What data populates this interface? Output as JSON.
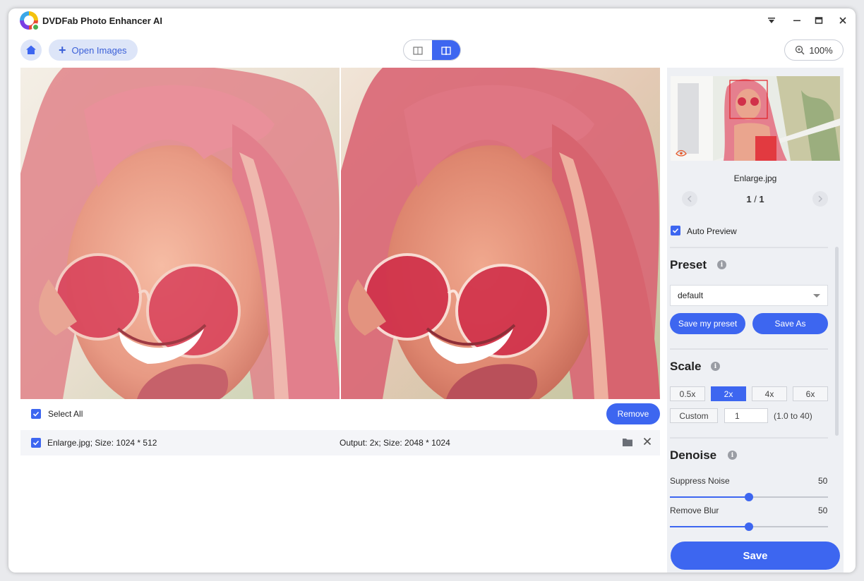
{
  "app": {
    "title": "DVDFab Photo Enhancer AI"
  },
  "toolbar": {
    "open_label": "Open Images",
    "zoom_label": "100%"
  },
  "list": {
    "select_all_label": "Select All",
    "remove_label": "Remove",
    "files": [
      {
        "name": "Enlarge.jpg; Size: 1024 * 512",
        "output": "Output: 2x; Size: 2048 * 1024"
      }
    ]
  },
  "side": {
    "thumb_name": "Enlarge.jpg",
    "page_current": "1",
    "page_sep": " / ",
    "page_total": "1",
    "auto_preview_label": "Auto Preview",
    "preset": {
      "title": "Preset",
      "selected": "default",
      "save_my_preset": "Save my preset",
      "save_as": "Save As"
    },
    "scale": {
      "title": "Scale",
      "options": [
        "0.5x",
        "2x",
        "4x",
        "6x"
      ],
      "selected": "2x",
      "custom_label": "Custom",
      "custom_value": "1",
      "range_note": "(1.0 to 40)"
    },
    "denoise": {
      "title": "Denoise",
      "sliders": [
        {
          "label": "Suppress Noise",
          "value": "50",
          "fraction": 0.5
        },
        {
          "label": "Remove Blur",
          "value": "50",
          "fraction": 0.5
        }
      ]
    },
    "save_label": "Save"
  },
  "colors": {
    "accent": "#3d66f0",
    "panel_bg": "#eef0f4"
  }
}
